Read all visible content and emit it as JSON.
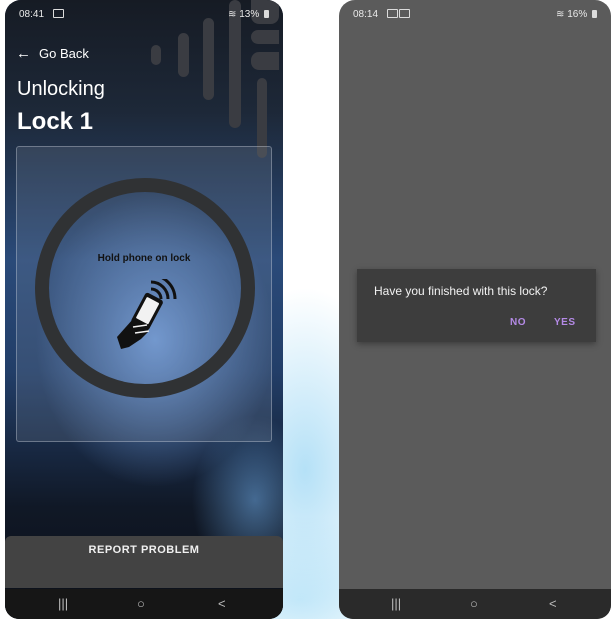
{
  "left_screen": {
    "status_bar": {
      "time": "08:41",
      "battery": "13%"
    },
    "back_label": "Go Back",
    "subtitle": "Unlocking",
    "title": "Lock 1",
    "scan_prompt": "Hold phone on lock",
    "scan_icon": "hand-phone-nfc-icon",
    "report_button_label": "REPORT PROBLEM"
  },
  "right_screen": {
    "status_bar": {
      "time": "08:14",
      "battery": "16%"
    },
    "dialog": {
      "message": "Have you finished with this lock?",
      "no_label": "NO",
      "yes_label": "YES"
    }
  },
  "nav_bar": {
    "recents_glyph": "|||",
    "home_glyph": "○",
    "back_glyph": "<"
  },
  "colors": {
    "dialog_accent": "#b48ae6",
    "dialog_bg": "#3d3d3d",
    "right_screen_bg": "#5b5b5b",
    "report_bar_bg": "#434343"
  }
}
